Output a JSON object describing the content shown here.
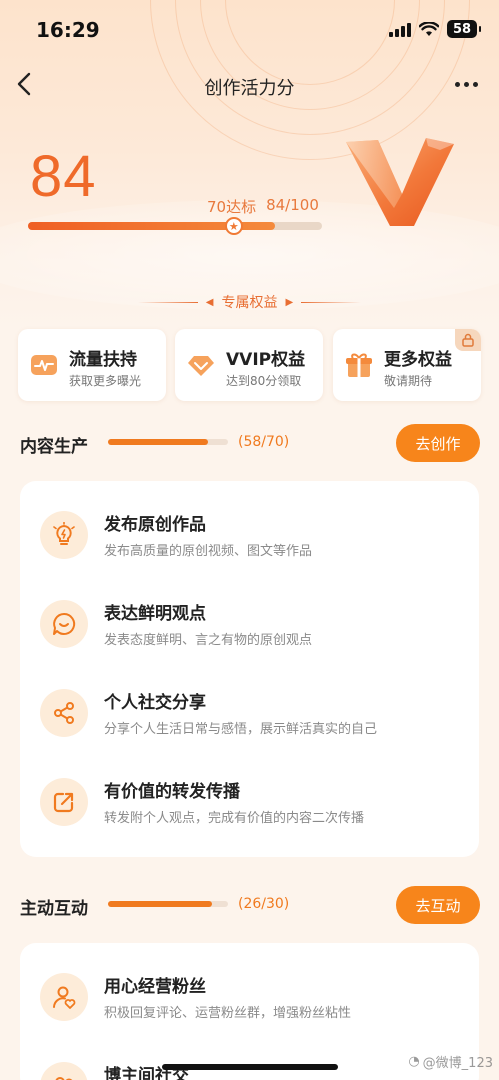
{
  "status": {
    "time": "16:29",
    "battery": "58"
  },
  "nav": {
    "title": "创作活力分"
  },
  "score": {
    "value": "84",
    "target_label": "70达标",
    "progress_label": "84/100",
    "progress_fraction": 0.84,
    "target_fraction": 0.7
  },
  "benefits": {
    "section_label": "专属权益",
    "items": [
      {
        "title": "流量扶持",
        "subtitle": "获取更多曝光",
        "icon": "traffic-icon"
      },
      {
        "title": "VVIP权益",
        "subtitle": "达到80分领取",
        "icon": "diamond-icon"
      },
      {
        "title": "更多权益",
        "subtitle": "敬请期待",
        "icon": "gift-icon",
        "locked": true
      }
    ]
  },
  "content_section": {
    "title": "内容生产",
    "count": "(58/70)",
    "progress_fraction": 0.83,
    "button": "去创作",
    "tasks": [
      {
        "title": "发布原创作品",
        "desc": "发布高质量的原创视频、图文等作品",
        "icon": "lightbulb-icon"
      },
      {
        "title": "表达鲜明观点",
        "desc": "发表态度鲜明、言之有物的原创观点",
        "icon": "chat-smile-icon"
      },
      {
        "title": "个人社交分享",
        "desc": "分享个人生活日常与感悟，展示鲜活真实的自己",
        "icon": "share-icon"
      },
      {
        "title": "有价值的转发传播",
        "desc": "转发附个人观点，完成有价值的内容二次传播",
        "icon": "forward-icon"
      }
    ]
  },
  "interaction_section": {
    "title": "主动互动",
    "count": "(26/30)",
    "progress_fraction": 0.87,
    "button": "去互动",
    "tasks": [
      {
        "title": "用心经营粉丝",
        "desc": "积极回复评论、运营粉丝群，增强粉丝粘性",
        "icon": "user-heart-icon"
      },
      {
        "title": "博主间社交",
        "desc": "",
        "icon": "bloggers-icon"
      }
    ]
  },
  "watermark": "@微博_123",
  "colors": {
    "accent": "#f7851b",
    "score": "#ef6a2a",
    "background": "#fdf4ec"
  }
}
